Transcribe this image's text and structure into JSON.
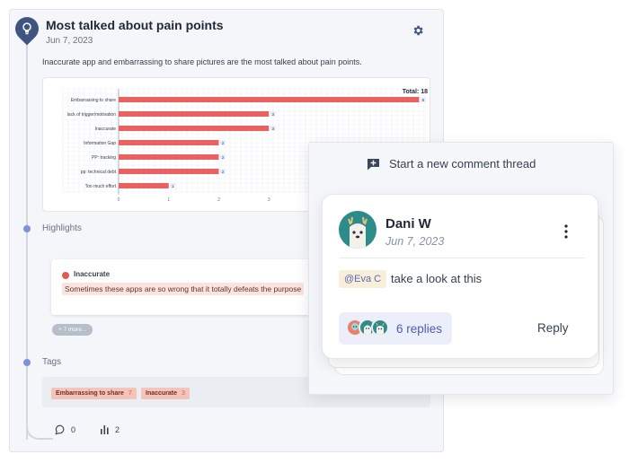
{
  "insight": {
    "title": "Most talked about pain points",
    "date": "Jun 7, 2023",
    "summary": "Inaccurate app and embarrassing to share pictures are the most talked about pain points.",
    "pin_icon": "lightbulb-icon",
    "settings_icon": "gear-icon"
  },
  "chart_data": {
    "type": "bar",
    "orientation": "horizontal",
    "total_label": "Total: 18",
    "categories": [
      "Embarrassing to share",
      "lack of trigger/motivation",
      "Inaccurate",
      "Information Gap",
      "PP: tracking",
      "pp: technical debt",
      "Too much effort"
    ],
    "values": [
      6,
      3,
      3,
      2,
      2,
      2,
      1
    ],
    "x_ticks": [
      "0",
      "1",
      "2",
      "3"
    ],
    "xlim": [
      0,
      6.1
    ],
    "bar_color": "#e8625f",
    "grid": true
  },
  "highlights": {
    "label": "Highlights",
    "items": [
      {
        "tag": "Inaccurate",
        "text": "Sometimes these apps are so wrong that it totally defeats the purpose"
      }
    ],
    "more_label": "+ 7 more..."
  },
  "tags": {
    "label": "Tags",
    "items": [
      {
        "name": "Embarrassing to share",
        "count": "7"
      },
      {
        "name": "Inaccurate",
        "count": "3"
      }
    ]
  },
  "footer": {
    "comments_count": "0",
    "stats_count": "2"
  },
  "comments": {
    "new_thread_label": "Start a new comment thread",
    "thread": {
      "author": "Dani W",
      "date": "Jun 7, 2023",
      "mention": "@Eva C",
      "body": "take a look at this",
      "replies_label": "6 replies",
      "reply_label": "Reply"
    }
  },
  "colors": {
    "accent": "#4c5db3",
    "bar": "#e8625f",
    "tag_bg": "#f4c3b9",
    "avatar_bg": "#2c8c89"
  }
}
